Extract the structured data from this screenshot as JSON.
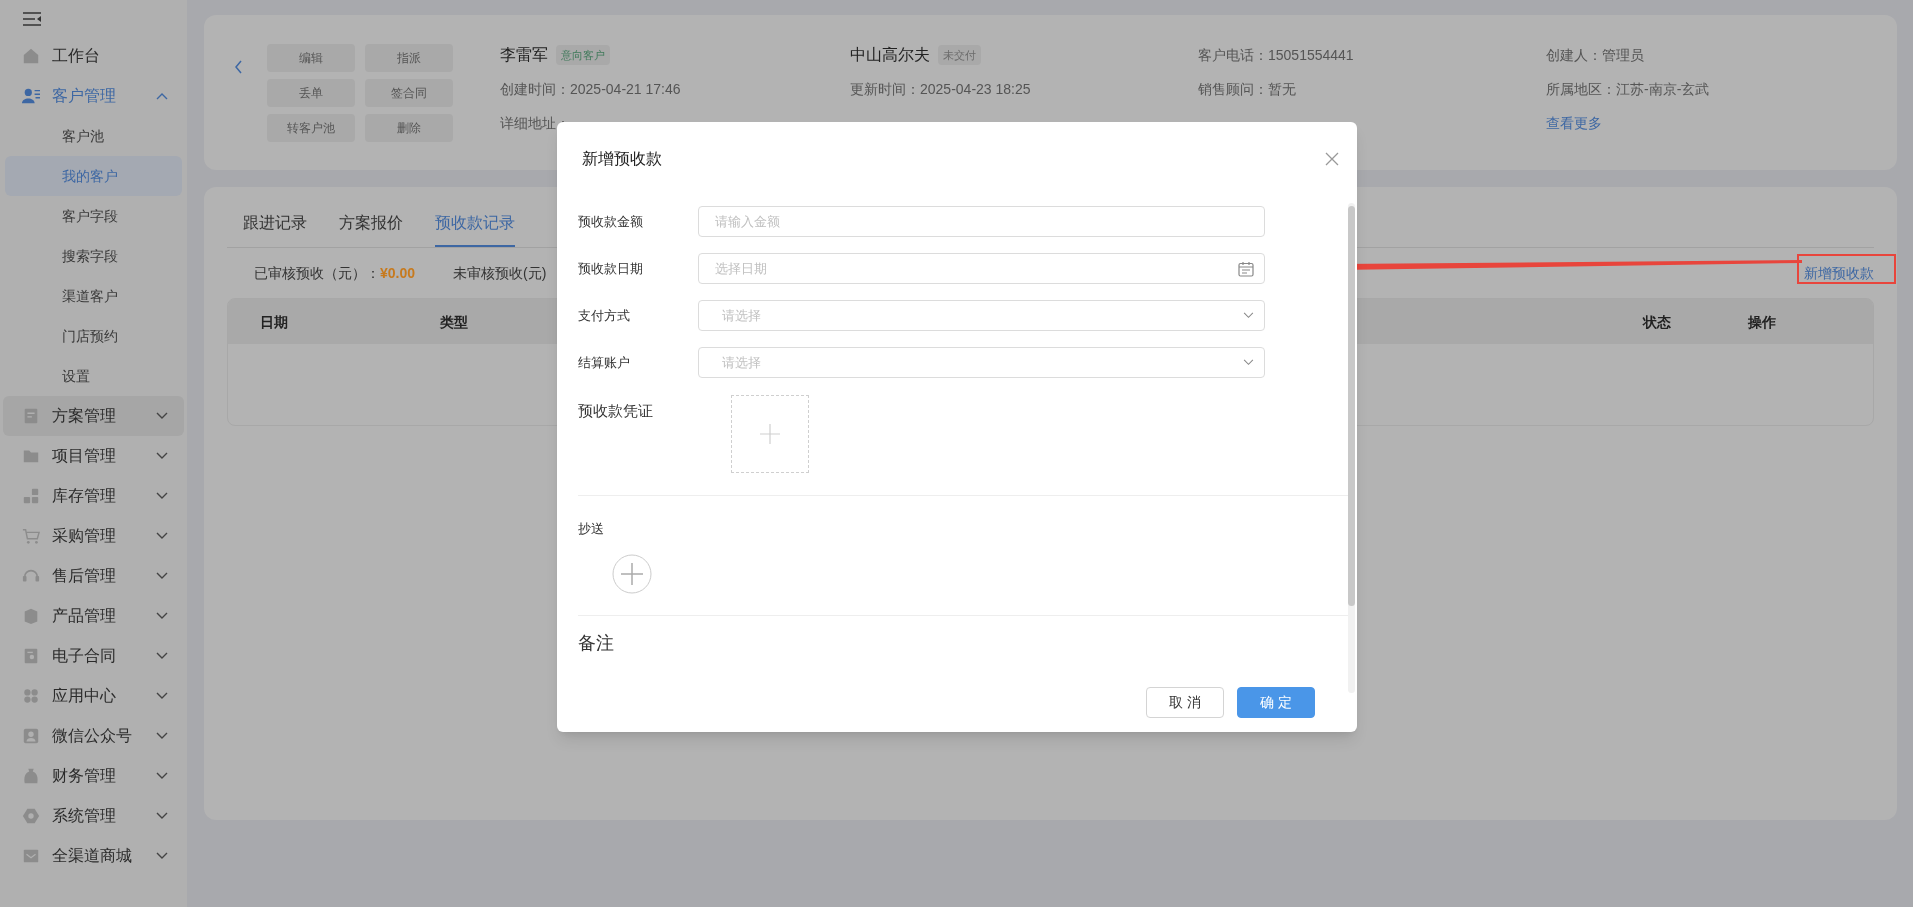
{
  "sidebar": {
    "items": [
      {
        "label": "工作台"
      },
      {
        "label": "客户管理",
        "expanded": true,
        "selected": true,
        "children": [
          {
            "label": "客户池",
            "selected": false
          },
          {
            "label": "我的客户",
            "selected": true
          },
          {
            "label": "客户字段",
            "selected": false
          },
          {
            "label": "搜索字段",
            "selected": false
          },
          {
            "label": "渠道客户",
            "selected": false
          },
          {
            "label": "门店预约",
            "selected": false
          },
          {
            "label": "设置",
            "selected": false
          }
        ]
      },
      {
        "label": "方案管理",
        "expanded": false,
        "hovered": true
      },
      {
        "label": "项目管理",
        "expanded": false
      },
      {
        "label": "库存管理",
        "expanded": false
      },
      {
        "label": "采购管理",
        "expanded": false
      },
      {
        "label": "售后管理",
        "expanded": false
      },
      {
        "label": "产品管理",
        "expanded": false
      },
      {
        "label": "电子合同",
        "expanded": false
      },
      {
        "label": "应用中心",
        "expanded": false
      },
      {
        "label": "微信公众号",
        "expanded": false
      },
      {
        "label": "财务管理",
        "expanded": false
      },
      {
        "label": "系统管理",
        "expanded": false
      },
      {
        "label": "全渠道商城",
        "expanded": false
      }
    ]
  },
  "customer": {
    "actions": [
      "编辑",
      "指派",
      "丢单",
      "签合同",
      "转客户池",
      "删除"
    ],
    "columns": [
      [
        {
          "kind": "title",
          "text": "李雷军",
          "tag": {
            "text": "意向客户",
            "color": "#3f7a5a"
          }
        },
        {
          "kind": "field",
          "text": "创建时间：2025-04-21 17:46"
        },
        {
          "kind": "field",
          "text": "详细地址："
        }
      ],
      [
        {
          "kind": "title",
          "text": "中山高尔夫",
          "tag": {
            "text": "未交付",
            "color": "#6b6b6b"
          }
        },
        {
          "kind": "field",
          "text": "更新时间：2025-04-23 18:25"
        }
      ],
      [
        {
          "kind": "field",
          "text": "客户电话：15051554441"
        },
        {
          "kind": "field",
          "text": "销售顾问：暂无"
        }
      ],
      [
        {
          "kind": "field",
          "text": "创建人：管理员"
        },
        {
          "kind": "field",
          "text": "所属地区：江苏-南京-玄武"
        },
        {
          "kind": "link",
          "text": "查看更多"
        }
      ]
    ]
  },
  "tabs": [
    {
      "label": "跟进记录",
      "selected": false
    },
    {
      "label": "方案报价",
      "selected": false
    },
    {
      "label": "预收款记录",
      "selected": true
    }
  ],
  "summary": [
    {
      "label": "已审核预收（元）：",
      "value": "¥0.00"
    },
    {
      "label": "未审核预收(元)"
    }
  ],
  "add_link": "新增预收款",
  "table": {
    "columns": [
      "日期",
      "类型",
      "状态",
      "操作"
    ]
  },
  "dialog": {
    "title": "新增预收款",
    "fields": [
      {
        "label": "预收款金额",
        "kind": "input",
        "placeholder": "请输入金额"
      },
      {
        "label": "预收款日期",
        "kind": "date",
        "placeholder": "选择日期"
      },
      {
        "label": "支付方式",
        "kind": "select",
        "placeholder": "请选择"
      },
      {
        "label": "结算账户",
        "kind": "select",
        "placeholder": "请选择"
      }
    ],
    "voucher_label": "预收款凭证",
    "cc_label": "抄送",
    "remark_label": "备注",
    "buttons": [
      {
        "label": "取 消",
        "kind": "secondary"
      },
      {
        "label": "确 定",
        "kind": "primary"
      }
    ]
  }
}
